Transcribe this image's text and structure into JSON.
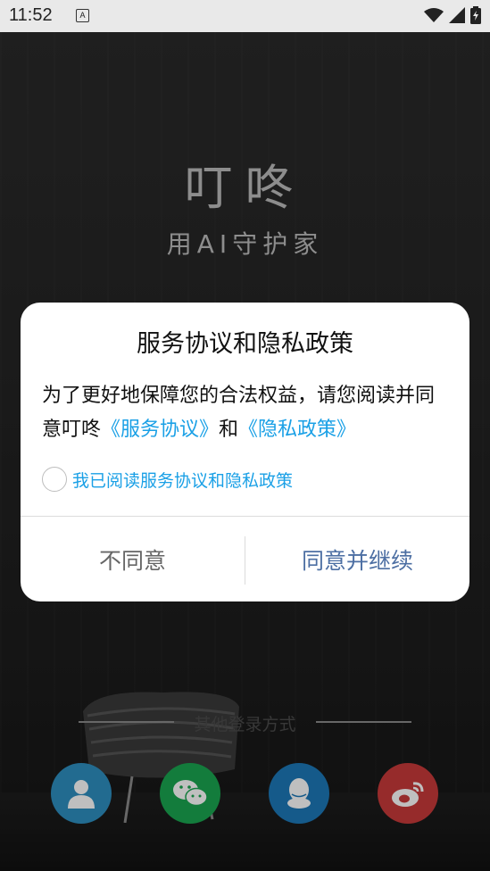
{
  "status_bar": {
    "time": "11:52",
    "notification_icon": "A"
  },
  "app": {
    "title": "叮咚",
    "slogan": "用AI守护家"
  },
  "dialog": {
    "title": "服务协议和隐私政策",
    "body_prefix": "为了更好地保障您的合法权益，请您阅读并同意叮咚",
    "service_link": "《服务协议》",
    "conjunction": "和",
    "privacy_link": "《隐私政策》",
    "checkbox_label": "我已阅读服务协议和隐私政策",
    "disagree_label": "不同意",
    "agree_label": "同意并继续"
  },
  "login": {
    "other_methods_label": "其他登录方式",
    "methods": [
      {
        "name": "account",
        "icon": "person-icon",
        "color": "#2e8fc0"
      },
      {
        "name": "wechat",
        "icon": "wechat-icon",
        "color": "#1aa650"
      },
      {
        "name": "qq",
        "icon": "qq-icon",
        "color": "#1c78b8"
      },
      {
        "name": "weibo",
        "icon": "weibo-icon",
        "color": "#c83a3a"
      }
    ]
  },
  "colors": {
    "link": "#1aa0e6",
    "agree": "#4d6fa3",
    "disagree": "#666666"
  }
}
